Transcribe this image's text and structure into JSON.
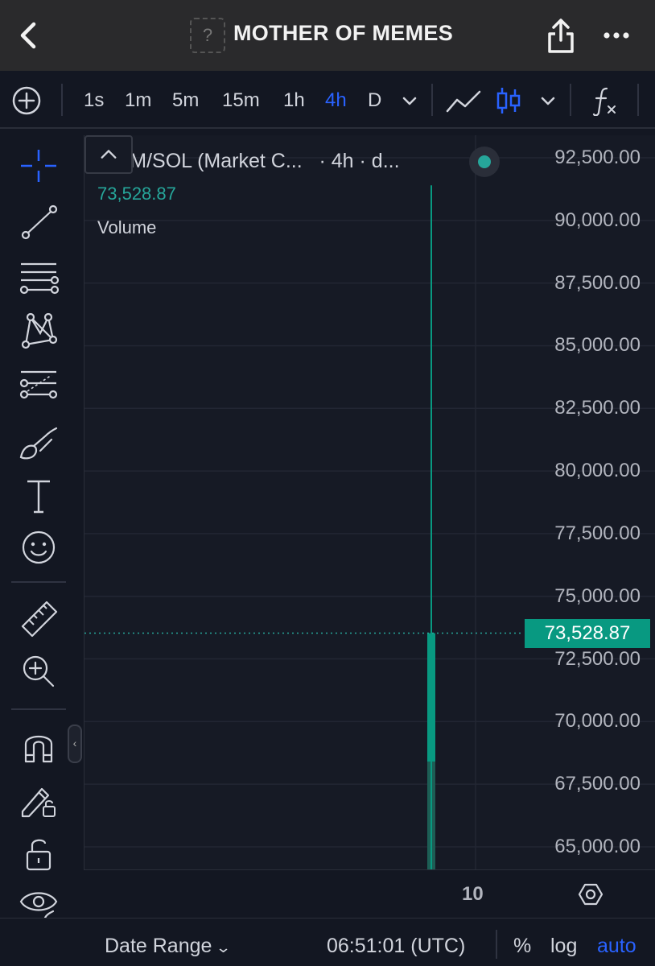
{
  "header": {
    "title": "MOTHER OF MEMES",
    "token_placeholder": "?"
  },
  "toolbar": {
    "intervals": [
      "1s",
      "1m",
      "5m",
      "15m",
      "1h",
      "4h",
      "D"
    ],
    "active_interval": "4h",
    "icons": [
      "add-icon",
      "chevron-down-icon",
      "line-chart-icon",
      "candles-icon",
      "chevron-down-icon",
      "indicators-icon"
    ]
  },
  "left_tools": [
    "crosshair-icon",
    "trend-line-icon",
    "horizontal-lines-icon",
    "pattern-icon",
    "fib-icon",
    "brush-icon",
    "text-icon",
    "emoji-icon",
    "ruler-icon",
    "zoom-in-icon",
    "magnet-icon",
    "lock-draw-icon",
    "lock-icon",
    "eye-icon"
  ],
  "legend": {
    "symbol": "MOM/SOL (Market C...",
    "meta": "· 4h · d...",
    "last_price": "73,528.87",
    "volume_label": "Volume"
  },
  "chart_data": {
    "type": "candlestick",
    "yaxis_ticks": [
      "92,500.00",
      "90,000.00",
      "87,500.00",
      "85,000.00",
      "82,500.00",
      "80,000.00",
      "77,500.00",
      "75,000.00",
      "72,500.00",
      "70,000.00",
      "67,500.00",
      "65,000.00"
    ],
    "tick_values": [
      92500,
      90000,
      87500,
      85000,
      82500,
      80000,
      77500,
      75000,
      72500,
      70000,
      67500,
      65000
    ],
    "ylim": [
      64100,
      93400
    ],
    "xaxis_ticks": [
      "10"
    ],
    "last_price_label": "73,528.87",
    "last_price": 73528.87,
    "candles": [
      {
        "high": 91400,
        "open": 68400,
        "close": 73528.87,
        "low": 64100
      }
    ],
    "volume_bar_value_fraction": 1.0,
    "up_color": "#089981",
    "grid": true
  },
  "time_axis": {
    "tick": "10"
  },
  "bottom": {
    "date_range": "Date Range",
    "clock": "06:51:01 (UTC)",
    "percent": "%",
    "log": "log",
    "auto": "auto"
  },
  "colors": {
    "accent": "#2962ff",
    "up": "#26a69a",
    "background": "#131722"
  }
}
